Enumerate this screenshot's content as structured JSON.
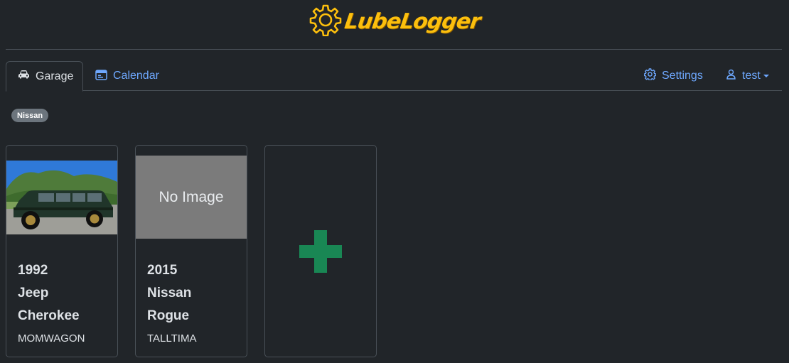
{
  "app": {
    "logo_text": "LubeLogger"
  },
  "nav": {
    "tabs": [
      {
        "label": "Garage",
        "icon": "car-icon",
        "active": true
      },
      {
        "label": "Calendar",
        "icon": "calendar-icon",
        "active": false
      }
    ],
    "settings_label": "Settings",
    "user_label": "test"
  },
  "filters": {
    "tags": [
      "Nissan"
    ]
  },
  "vehicles": [
    {
      "year": "1992",
      "make": "Jeep",
      "model": "Cherokee",
      "plate": "MOMWAGON",
      "has_image": true
    },
    {
      "year": "2015",
      "make": "Nissan",
      "model": "Rogue",
      "plate": "TALLTIMA",
      "has_image": false,
      "no_image_label": "No Image"
    }
  ],
  "add_vehicle": {
    "icon": "plus-icon",
    "color": "#198754"
  },
  "colors": {
    "accent": "#6ea8fe",
    "logo": "#fcbf0d",
    "background": "#212529",
    "badge": "#6c757d"
  }
}
